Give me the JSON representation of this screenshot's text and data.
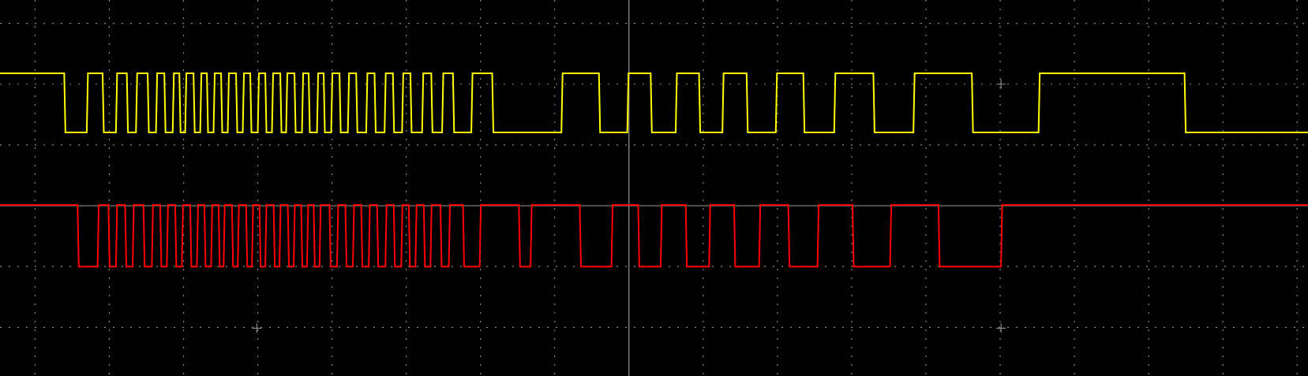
{
  "traces": [
    {
      "color": "#ffff00"
    },
    {
      "color": "#ff0000"
    }
  ]
}
